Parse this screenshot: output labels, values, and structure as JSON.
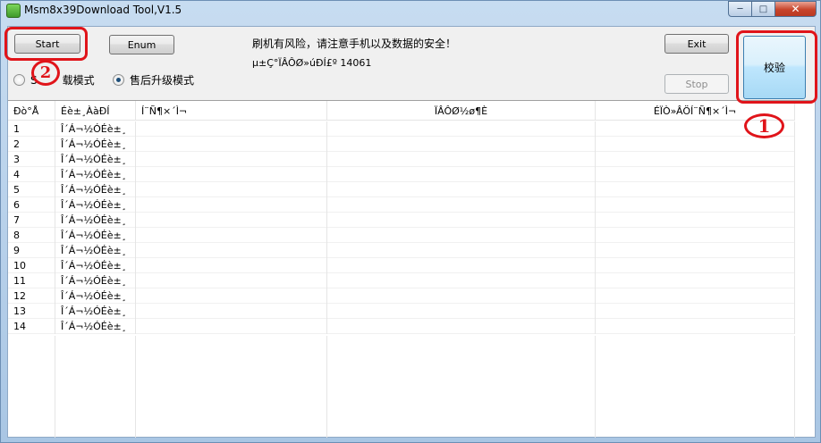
{
  "window": {
    "title": "Msm8x39Download Tool,V1.5"
  },
  "toolbar": {
    "start_label": "Start",
    "enum_label": "Enum",
    "exit_label": "Exit",
    "stop_label": "Stop",
    "verify_label": "校验"
  },
  "info": {
    "warning": "刷机有风险，请注意手机以及数据的安全！",
    "version": "µ±Ç°ÏÂÔØ»úÐÍ£º 14061"
  },
  "modes": [
    {
      "label": "S",
      "label_tail": "载模式",
      "checked": false
    },
    {
      "label": "售后升级模式",
      "checked": true
    }
  ],
  "table": {
    "columns": [
      "Ðò°Å",
      "Éè±¸ÀàÐÍ",
      "Í¨Ñ¶×´Ì¬",
      "ÏÂÔØ½ø¶È",
      "ÉÏÒ»ÂÖÍ¨Ñ¶×´Ì¬"
    ],
    "rows": [
      {
        "num": "1",
        "type": "Î´Á¬½ÓÉè±¸"
      },
      {
        "num": "2",
        "type": "Î´Á¬½ÓÉè±¸"
      },
      {
        "num": "3",
        "type": "Î´Á¬½ÓÉè±¸"
      },
      {
        "num": "4",
        "type": "Î´Á¬½ÓÉè±¸"
      },
      {
        "num": "5",
        "type": "Î´Á¬½ÓÉè±¸"
      },
      {
        "num": "6",
        "type": "Î´Á¬½ÓÉè±¸"
      },
      {
        "num": "7",
        "type": "Î´Á¬½ÓÉè±¸"
      },
      {
        "num": "8",
        "type": "Î´Á¬½ÓÉè±¸"
      },
      {
        "num": "9",
        "type": "Î´Á¬½ÓÉè±¸"
      },
      {
        "num": "10",
        "type": "Î´Á¬½ÓÉè±¸"
      },
      {
        "num": "11",
        "type": "Î´Á¬½ÓÉè±¸"
      },
      {
        "num": "12",
        "type": "Î´Á¬½ÓÉè±¸"
      },
      {
        "num": "13",
        "type": "Î´Á¬½ÓÉè±¸"
      },
      {
        "num": "14",
        "type": "Î´Á¬½ÓÉè±¸"
      }
    ]
  },
  "annotations": {
    "one": "1",
    "two": "2",
    "color": "#e0141a"
  }
}
